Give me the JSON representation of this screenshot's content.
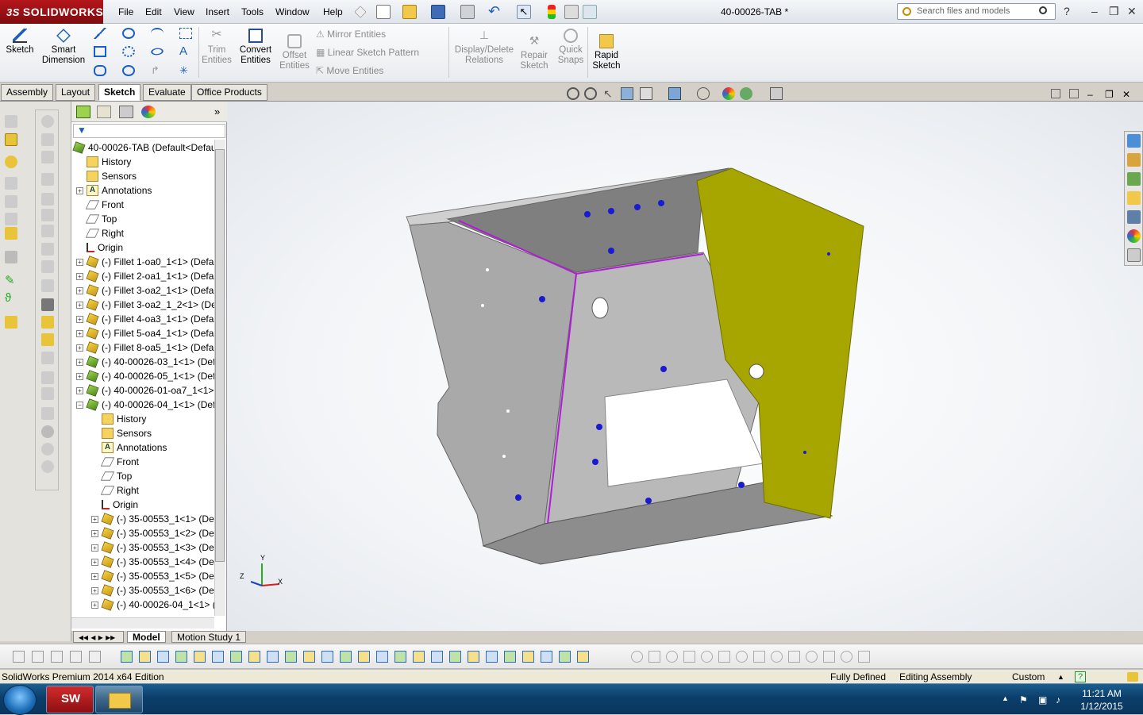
{
  "app": {
    "logo_text": "SOLIDWORKS",
    "logo_prefix": "3S",
    "document_title": "40-00026-TAB *",
    "search_placeholder": "Search files and models",
    "help_icon": "?"
  },
  "menu": [
    "File",
    "Edit",
    "View",
    "Insert",
    "Tools",
    "Window",
    "Help"
  ],
  "command_manager": {
    "sketch": "Sketch",
    "smart_dimension_1": "Smart",
    "smart_dimension_2": "Dimension",
    "trim_1": "Trim",
    "trim_2": "Entities",
    "convert_1": "Convert",
    "convert_2": "Entities",
    "offset_1": "Offset",
    "offset_2": "Entities",
    "mirror": "Mirror Entities",
    "linear_pattern": "Linear Sketch Pattern",
    "move": "Move Entities",
    "display_delete_1": "Display/Delete",
    "display_delete_2": "Relations",
    "repair_1": "Repair",
    "repair_2": "Sketch",
    "quick_1": "Quick",
    "quick_2": "Snaps",
    "rapid_1": "Rapid",
    "rapid_2": "Sketch"
  },
  "tabs": [
    "Assembly",
    "Layout",
    "Sketch",
    "Evaluate",
    "Office Products"
  ],
  "active_tab": "Sketch",
  "tree": {
    "root": "40-00026-TAB  (Default<Defau",
    "items": [
      {
        "label": "History",
        "icon": "folder-icon",
        "level": 1,
        "expand": ""
      },
      {
        "label": "Sensors",
        "icon": "folder-icon",
        "level": 1,
        "expand": ""
      },
      {
        "label": "Annotations",
        "icon": "annotation-icon",
        "level": 1,
        "expand": "+"
      },
      {
        "label": "Front",
        "icon": "plane-icon",
        "level": 1,
        "expand": ""
      },
      {
        "label": "Top",
        "icon": "plane-icon",
        "level": 1,
        "expand": ""
      },
      {
        "label": "Right",
        "icon": "plane-icon",
        "level": 1,
        "expand": ""
      },
      {
        "label": "Origin",
        "icon": "origin-icon",
        "level": 1,
        "expand": ""
      },
      {
        "label": "(-) Fillet 1-oa0_1<1> (Defa",
        "icon": "part-icon",
        "level": 1,
        "expand": "+"
      },
      {
        "label": "(-) Fillet 2-oa1_1<1> (Defa",
        "icon": "part-icon",
        "level": 1,
        "expand": "+"
      },
      {
        "label": "(-) Fillet 3-oa2_1<1> (Defa",
        "icon": "part-icon",
        "level": 1,
        "expand": "+"
      },
      {
        "label": "(-) Fillet 3-oa2_1_2<1> (De",
        "icon": "part-icon",
        "level": 1,
        "expand": "+"
      },
      {
        "label": "(-) Fillet 4-oa3_1<1> (Defa",
        "icon": "part-icon",
        "level": 1,
        "expand": "+"
      },
      {
        "label": "(-) Fillet 5-oa4_1<1> (Defa",
        "icon": "part-icon",
        "level": 1,
        "expand": "+"
      },
      {
        "label": "(-) Fillet 8-oa5_1<1> (Defa",
        "icon": "part-icon",
        "level": 1,
        "expand": "+"
      },
      {
        "label": "(-) 40-00026-03_1<1> (Def",
        "icon": "assembly-icon",
        "level": 1,
        "expand": "+"
      },
      {
        "label": "(-) 40-00026-05_1<1> (Def",
        "icon": "assembly-icon",
        "level": 1,
        "expand": "+"
      },
      {
        "label": "(-) 40-00026-01-oa7_1<1>",
        "icon": "assembly-icon",
        "level": 1,
        "expand": "+"
      },
      {
        "label": "(-) 40-00026-04_1<1> (Def",
        "icon": "assembly-icon",
        "level": 1,
        "expand": "−"
      },
      {
        "label": "History",
        "icon": "folder-icon",
        "level": 2,
        "expand": ""
      },
      {
        "label": "Sensors",
        "icon": "folder-icon",
        "level": 2,
        "expand": ""
      },
      {
        "label": "Annotations",
        "icon": "annotation-icon",
        "level": 2,
        "expand": ""
      },
      {
        "label": "Front",
        "icon": "plane-icon",
        "level": 2,
        "expand": ""
      },
      {
        "label": "Top",
        "icon": "plane-icon",
        "level": 2,
        "expand": ""
      },
      {
        "label": "Right",
        "icon": "plane-icon",
        "level": 2,
        "expand": ""
      },
      {
        "label": "Origin",
        "icon": "origin-icon",
        "level": 2,
        "expand": ""
      },
      {
        "label": "(-) 35-00553_1<1> (Def",
        "icon": "part-icon",
        "level": 2,
        "expand": "+"
      },
      {
        "label": "(-) 35-00553_1<2> (Def",
        "icon": "part-icon",
        "level": 2,
        "expand": "+"
      },
      {
        "label": "(-) 35-00553_1<3> (Def",
        "icon": "part-icon",
        "level": 2,
        "expand": "+"
      },
      {
        "label": "(-) 35-00553_1<4> (Def",
        "icon": "part-icon",
        "level": 2,
        "expand": "+"
      },
      {
        "label": "(-) 35-00553_1<5> (Def",
        "icon": "part-icon",
        "level": 2,
        "expand": "+"
      },
      {
        "label": "(-) 35-00553_1<6> (Def",
        "icon": "part-icon",
        "level": 2,
        "expand": "+"
      },
      {
        "label": "(-) 40-00026-04_1<1> (",
        "icon": "part-icon",
        "level": 2,
        "expand": "+"
      }
    ]
  },
  "bottom_tabs": [
    "Model",
    "Motion Study 1"
  ],
  "active_bottom_tab": "Model",
  "triad": {
    "x": "X",
    "y": "Y",
    "z": "Z"
  },
  "status": {
    "edition": "SolidWorks Premium 2014 x64 Edition",
    "defined": "Fully Defined",
    "mode": "Editing Assembly",
    "units": "Custom"
  },
  "taskbar": {
    "time": "11:21 AM",
    "date": "1/12/2015"
  },
  "colors": {
    "accent": "#b5161b",
    "model_gray": "#a9a9a9",
    "model_yellow": "#a7a600",
    "edge_magenta": "#b21cd8",
    "hole_blue": "#1a1ad0"
  }
}
